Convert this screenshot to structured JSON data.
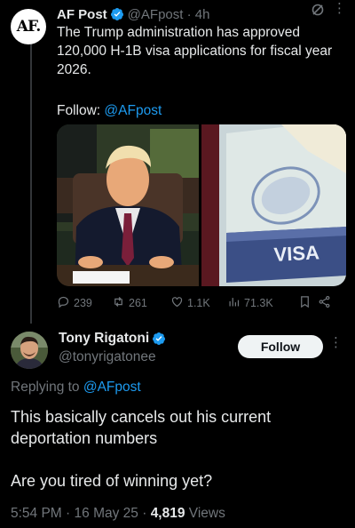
{
  "parent_tweet": {
    "avatar_text": "AF.",
    "name": "AF Post",
    "handle": "@AFpost",
    "time": "4h",
    "text": "The Trump administration has approved 120,000 H-1B visa applications for fiscal year 2026.",
    "follow_prefix": "Follow: ",
    "follow_handle": "@AFpost",
    "media": [
      {
        "icon": "photo-of-man-at-desk"
      },
      {
        "icon": "photo-of-passport-visa",
        "visible_text": "VISA"
      }
    ],
    "stats": {
      "replies": "239",
      "reposts": "261",
      "likes": "1.1K",
      "views": "71.3K"
    }
  },
  "reply_tweet": {
    "name": "Tony Rigatoni",
    "handle": "@tonyrigatonee",
    "follow_label": "Follow",
    "replying_prefix": "Replying to ",
    "replying_handle": "@AFpost",
    "text": "This basically cancels out his current deportation numbers\n\nAre you tired of winning yet?",
    "time": "5:54 PM",
    "date": "16 May 25",
    "views_count": "4,819",
    "views_label": "Views"
  },
  "colors": {
    "background": "#000000",
    "text": "#e7e9ea",
    "secondary": "#71767b",
    "link": "#1d9bf0",
    "verified": "#1d9bf0"
  }
}
